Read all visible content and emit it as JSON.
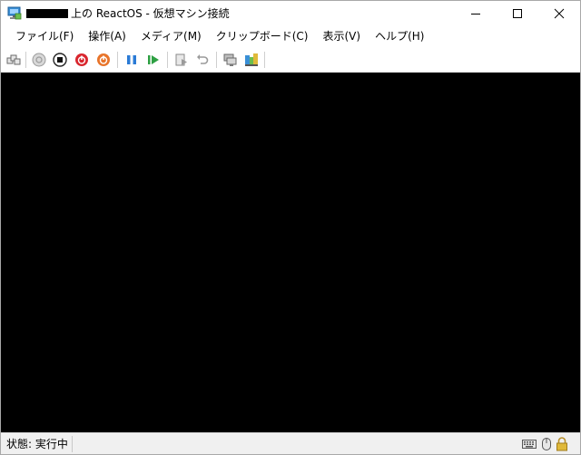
{
  "window": {
    "title": "上の ReactOS - 仮想マシン接続"
  },
  "menu": [
    {
      "label": "ファイル(F)"
    },
    {
      "label": "操作(A)"
    },
    {
      "label": "メディア(M)"
    },
    {
      "label": "クリップボード(C)"
    },
    {
      "label": "表示(V)"
    },
    {
      "label": "ヘルプ(H)"
    }
  ],
  "toolbar": {
    "icons": [
      "ctrl-alt-del-icon",
      "start-icon",
      "turn-off-icon",
      "shut-down-icon",
      "power-icon",
      "pause-icon",
      "resume-icon",
      "checkpoint-icon",
      "revert-icon",
      "enhanced-session-icon",
      "share-icon"
    ]
  },
  "status": {
    "text": "状態: 実行中"
  },
  "colors": {
    "screen": "#000000",
    "statusbar": "#f0f0f0",
    "stop_red": "#d9262e",
    "power_orange": "#e8742a",
    "pause_blue": "#2b7bd6",
    "play_green": "#2ea043"
  }
}
